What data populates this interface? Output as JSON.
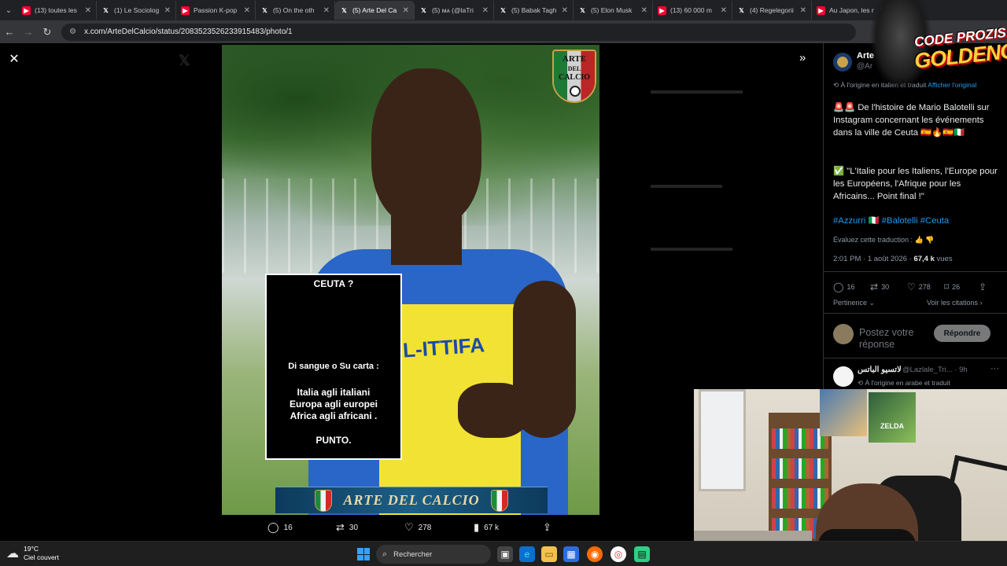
{
  "browser": {
    "tabs": [
      {
        "label": "(13) toutes les",
        "favicon": "youtube-icon",
        "active": false
      },
      {
        "label": "(1) Le Sociolog",
        "favicon": "x-icon",
        "active": false
      },
      {
        "label": "Passion K-pop",
        "favicon": "youtube-icon",
        "active": false
      },
      {
        "label": "(5) On the oth",
        "favicon": "x-icon",
        "active": false
      },
      {
        "label": "(5) Arte Del Ca",
        "favicon": "x-icon",
        "active": true
      },
      {
        "label": "(5) ᴍᴀ (@laTri",
        "favicon": "x-icon",
        "active": false
      },
      {
        "label": "(5) Babak Tagh",
        "favicon": "x-icon",
        "active": false
      },
      {
        "label": "(5) Elon Musk",
        "favicon": "x-icon",
        "active": false
      },
      {
        "label": "(13) 60 000 m",
        "favicon": "youtube-icon",
        "active": false
      },
      {
        "label": "(4) Regelegorii",
        "favicon": "x-icon",
        "active": false
      },
      {
        "label": "Au Japon, les r",
        "favicon": "youtube-icon",
        "active": false
      }
    ],
    "url": "x.com/ArteDelCalcio/status/2083523526233915483/photo/1"
  },
  "photo": {
    "logo_line1": "ARTE",
    "logo_line2": "DEL",
    "logo_line3": "CALCIO",
    "shirt_text": "L-ITTIFA",
    "story_card": {
      "title": "CEUTA ?",
      "line1": "Di sangue o Su carta :",
      "line2": "Italia agli italiani",
      "line3": "Europa agli europei",
      "line4": "Africa agli africani .",
      "line5": "PUNTO."
    },
    "banner_text": "ARTE DEL CALCIO"
  },
  "photo_actions": {
    "replies": "16",
    "reposts": "30",
    "likes": "278",
    "views": "67 k"
  },
  "tweet": {
    "author_name": "Arte",
    "author_handle": "@Ar",
    "translated_note": "À l'origine en italien et traduit",
    "show_original": "Afficher l'original",
    "text_1": "🚨🚨 De l'histoire de Mario Balotelli sur Instagram concernant les événements dans la ville de Ceuta 🇪🇦🔥🇪🇸🇮🇹",
    "text_2": "✅ \"L'Italie pour les Italiens, l'Europe pour les Européens, l'Afrique pour les Africains... Point final !\"",
    "hashtags": "#Azzurri 🇮🇹 #Balotelli #Ceuta",
    "rate_translation": "Évaluez cette traduction :",
    "time": "2:01 PM · 1 août 2026 ·",
    "views_count": "67,4 k",
    "views_label": "vues",
    "stats": {
      "replies": "16",
      "reposts": "30",
      "likes": "278",
      "bookmarks": "26"
    },
    "relevance": "Pertinence",
    "view_quotes": "Voir les citations",
    "reply_placeholder": "Postez votre réponse",
    "reply_button": "Répondre"
  },
  "reply": {
    "name": "لاتسيو الباتس",
    "handle": "@Lazlale_Tri... · 9h",
    "note": "À l'origine en arabe et traduit"
  },
  "promo": {
    "line1": "CODE PROZIS",
    "line2": "GOLDENG"
  },
  "webcam": {
    "poster_text": "ZELDA"
  },
  "taskbar": {
    "temperature": "19°C",
    "weather": "Ciel couvert",
    "search_placeholder": "Rechercher"
  }
}
